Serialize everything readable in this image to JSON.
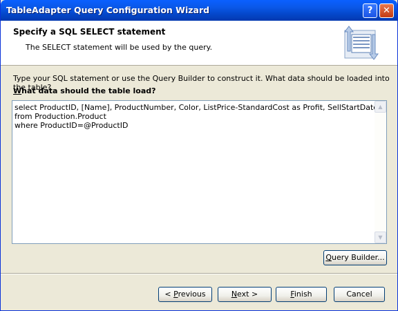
{
  "window": {
    "title": "TableAdapter Query Configuration Wizard",
    "help_glyph": "?",
    "close_glyph": "✕"
  },
  "header": {
    "title": "Specify a SQL SELECT statement",
    "subtitle": "The SELECT statement will be used by the query.",
    "icon": "wizard-data-icon"
  },
  "body": {
    "instruction": "Type your SQL statement or use the Query Builder to construct it. What data should be loaded into the table?",
    "prompt_accel": "W",
    "prompt_rest": "hat data should the table load?",
    "sql_text": "select ProductID, [Name], ProductNumber, Color, ListPrice-StandardCost as Profit, SellStartDate\nfrom Production.Product\nwhere ProductID=@ProductID"
  },
  "buttons": {
    "query_builder_accel": "Q",
    "query_builder_rest": "uery Builder...",
    "previous_pre": "< ",
    "previous_accel": "P",
    "previous_rest": "revious",
    "next_accel": "N",
    "next_rest": "ext >",
    "finish_accel": "F",
    "finish_rest": "inish",
    "cancel": "Cancel"
  },
  "colors": {
    "titlebar": "#0a58e8",
    "dialog_bg": "#ece9d8",
    "header_bg": "#ffffff",
    "button_border": "#003c74"
  }
}
